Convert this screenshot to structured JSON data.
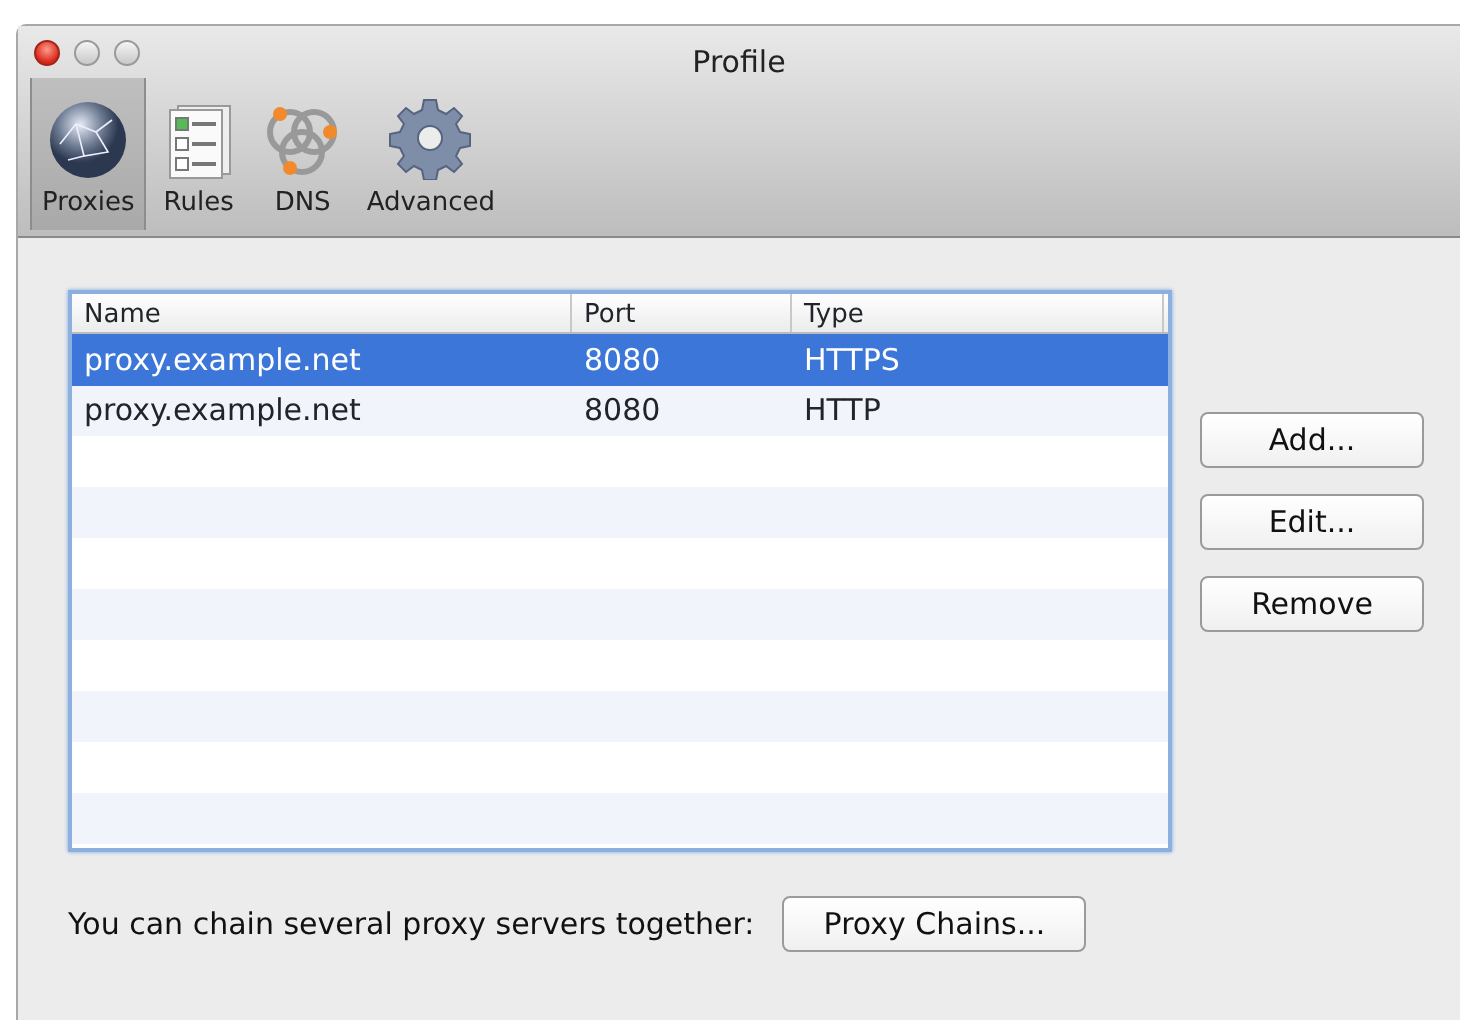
{
  "window": {
    "title": "Profile"
  },
  "toolbar": [
    {
      "label": "Proxies",
      "kind": "globe",
      "selected": true
    },
    {
      "label": "Rules",
      "kind": "rules",
      "selected": false
    },
    {
      "label": "DNS",
      "kind": "dns",
      "selected": false
    },
    {
      "label": "Advanced",
      "kind": "gear",
      "selected": false
    }
  ],
  "table": {
    "columns": [
      "Name",
      "Port",
      "Type"
    ],
    "rows": [
      {
        "cells": [
          "proxy.example.net",
          "8080",
          "HTTPS"
        ],
        "selected": true
      },
      {
        "cells": [
          "proxy.example.net",
          "8080",
          "HTTP"
        ],
        "selected": false
      }
    ]
  },
  "buttons": [
    "Add...",
    "Edit...",
    "Remove"
  ],
  "footer": {
    "text": "You can chain several proxy servers together:",
    "button": "Proxy Chains..."
  }
}
